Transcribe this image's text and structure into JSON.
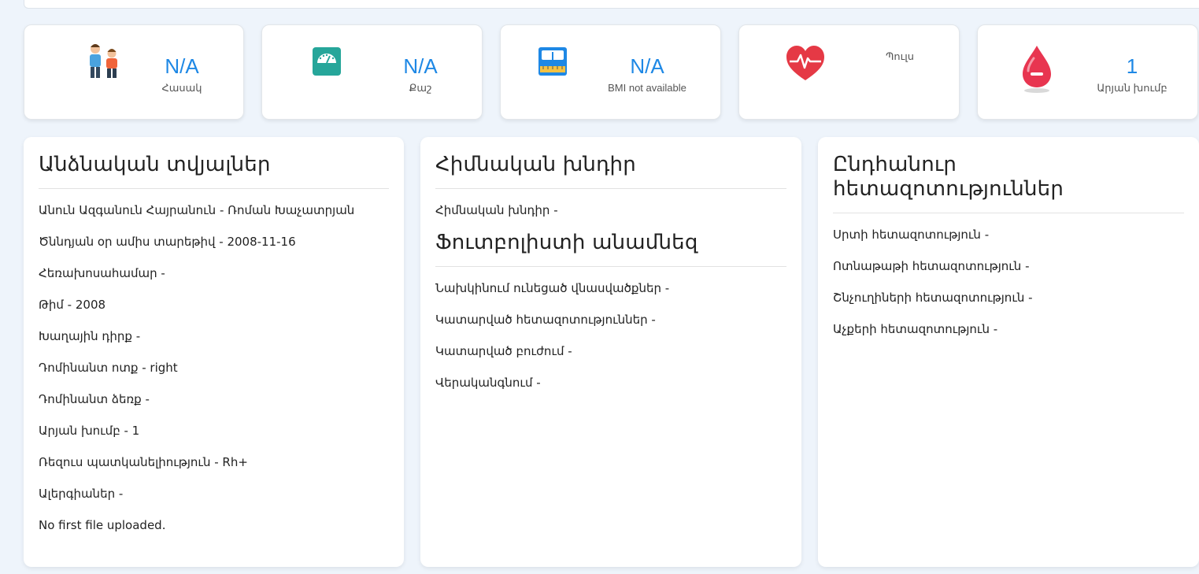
{
  "stats": [
    {
      "value": "N/A",
      "label": "Հասակ",
      "icon": "people-icon"
    },
    {
      "value": "N/A",
      "label": "Քաշ",
      "icon": "weight-scale-icon"
    },
    {
      "value": "N/A",
      "label": "BMI not available",
      "icon": "bmi-scale-icon"
    },
    {
      "value": "",
      "label": "Պուլս",
      "icon": "heart-pulse-icon"
    },
    {
      "value": "1",
      "label": "Արյան խումբ",
      "icon": "blood-drop-icon"
    }
  ],
  "personal": {
    "title": "Անձնական տվյալներ",
    "rows": [
      "Անուն Ազգանուն Հայրանուն - Ռոման Խաչատրյան",
      "Ծննդյան օր ամիս տարեթիվ - 2008-11-16",
      "Հեռախոսահամար -",
      "Թիմ - 2008",
      "Խաղային դիրք -",
      "Դոմինանտ ոտք - right",
      "Դոմինանտ ձեռք -",
      "Արյան խումբ - 1",
      "Ռեզուս պատկանելիություն - Rh+",
      "Ալերգիաներ -",
      "No first file uploaded."
    ]
  },
  "problem": {
    "title": "Հիմնական խնդիր",
    "row": "Հիմնական խնդիր -",
    "history_title": "Ֆուտբոլիստի անամնեզ",
    "history_rows": [
      "Նախկինում ունեցած վնասվածքներ -",
      "Կատարված հետազոտություններ -",
      "Կատարված բուժում -",
      "Վերականգնում -"
    ]
  },
  "exams": {
    "title": "Ընդհանուր հետազոտություններ",
    "rows": [
      "Սրտի հետազոտություն -",
      "Ոտնաթաթի հետազոտություն -",
      "Շնչուղիների հետազոտություն -",
      "Աչքերի հետազոտություն -"
    ]
  },
  "colors": {
    "accent": "#1e88e5",
    "background": "#eef4fb"
  }
}
